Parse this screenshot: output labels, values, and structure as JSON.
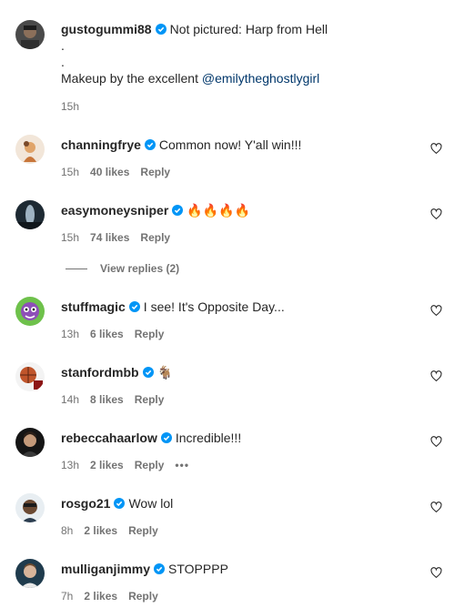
{
  "caption": {
    "username": "gustogummi88",
    "line1": "Not pictured: Harp from Hell",
    "dot1": ".",
    "dot2": ".",
    "makeup_prefix": "Makeup by the excellent",
    "mention": "@emilytheghostlygirl",
    "time": "15h"
  },
  "comments": [
    {
      "username": "channingfrye",
      "text": "Common now! Y'all win!!!",
      "time": "15h",
      "likes": "40 likes",
      "reply": "Reply"
    },
    {
      "username": "easymoneysniper",
      "text": "🔥🔥🔥🔥",
      "time": "15h",
      "likes": "74 likes",
      "reply": "Reply"
    },
    {
      "username": "stuffmagic",
      "text": "I see! It's Opposite Day...",
      "time": "13h",
      "likes": "6 likes",
      "reply": "Reply"
    },
    {
      "username": "stanfordmbb",
      "text": "🐐",
      "time": "14h",
      "likes": "8 likes",
      "reply": "Reply"
    },
    {
      "username": "rebeccahaarlow",
      "text": "Incredible!!!",
      "time": "13h",
      "likes": "2 likes",
      "reply": "Reply",
      "more": "•••"
    },
    {
      "username": "rosgo21",
      "text": "Wow lol",
      "time": "8h",
      "likes": "2 likes",
      "reply": "Reply"
    },
    {
      "username": "mulliganjimmy",
      "text": "STOPPPP",
      "time": "7h",
      "likes": "2 likes",
      "reply": "Reply"
    }
  ],
  "view_replies": "View replies (2)",
  "colors": {
    "verified_blue": "#0095f6",
    "muted_text": "#737373",
    "mention_blue": "#00376b"
  }
}
